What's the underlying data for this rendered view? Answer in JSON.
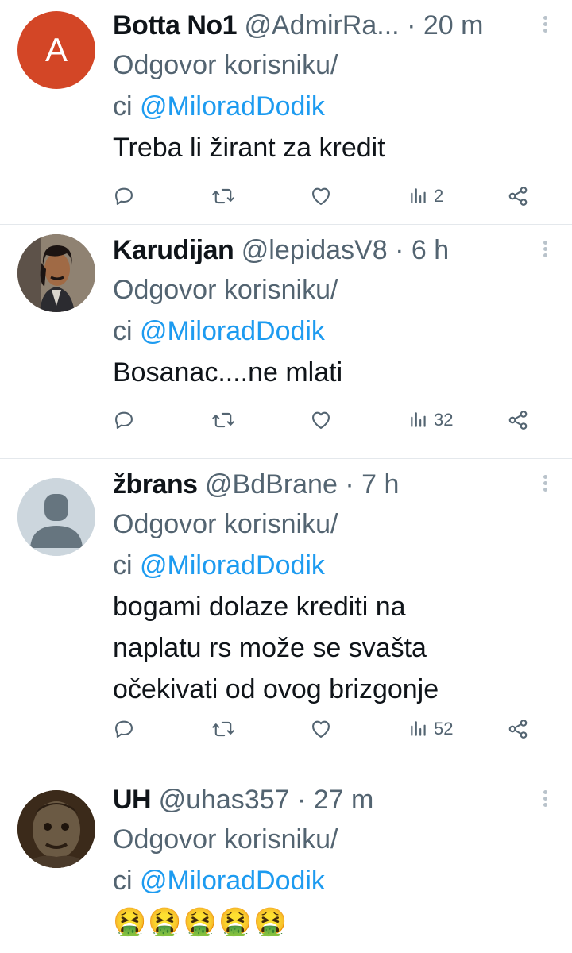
{
  "tweets": [
    {
      "name": "Botta No1",
      "handle": "@AdmirRa...",
      "separator": "·",
      "time": "20 m",
      "avatar_letter": "A",
      "reply_prefix": "Odgovor korisniku/",
      "reply_prefix2": "ci",
      "reply_to": "@MiloradDodik",
      "text_lines": [
        "Treba li žirant za kredit"
      ],
      "views": "2"
    },
    {
      "name": "Karudijan",
      "handle": "@lepidasV8",
      "separator": "·",
      "time": "6 h",
      "reply_prefix": "Odgovor korisniku/",
      "reply_prefix2": "ci",
      "reply_to": "@MiloradDodik",
      "text_lines": [
        "Bosanac....ne mlati"
      ],
      "views": "32"
    },
    {
      "name": "žbrans",
      "handle": "@BdBrane",
      "separator": "·",
      "time": "7 h",
      "reply_prefix": "Odgovor korisniku/",
      "reply_prefix2": "ci",
      "reply_to": "@MiloradDodik",
      "text_lines": [
        "bogami dolaze krediti na",
        "naplatu rs može se svašta",
        "očekivati od ovog brizgonje"
      ],
      "views": "52"
    },
    {
      "name": "UH",
      "handle": "@uhas357",
      "separator": "·",
      "time": "27 m",
      "reply_prefix": "Odgovor korisniku/",
      "reply_prefix2": "ci",
      "reply_to": "@MiloradDodik",
      "emoji": "🤮🤮🤮🤮🤮"
    }
  ],
  "icons": {
    "reply": "reply-icon",
    "retweet": "retweet-icon",
    "like": "heart-icon",
    "views": "views-icon",
    "share": "share-icon",
    "more": "more-icon"
  },
  "colors": {
    "mention": "#1d9bf0",
    "secondary_text": "#536471",
    "avatar_a": "#d34626"
  }
}
